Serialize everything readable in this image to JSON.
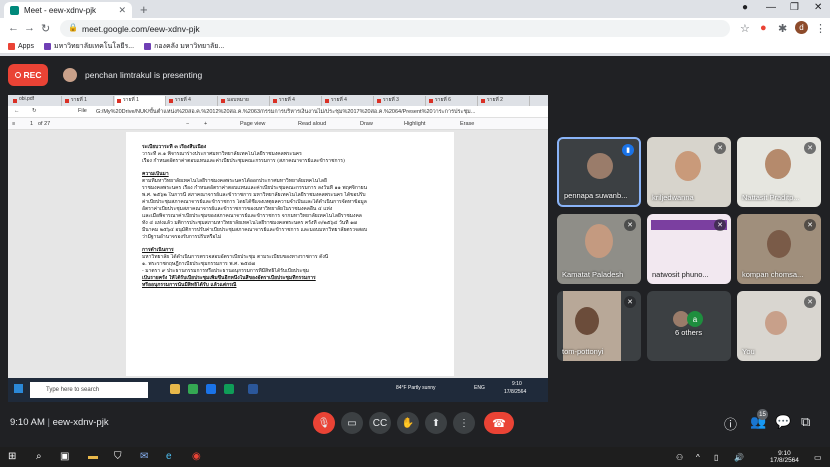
{
  "browser": {
    "tab_title": "Meet - eew-xdnv-pjk",
    "url": "meet.google.com/eew-xdnv-pjk",
    "bookmarks": [
      {
        "label": "Apps",
        "color": "#ea4335"
      },
      {
        "label": "มหาวิทยาลัยเทคโนโลยีร...",
        "color": "#6f3fb5"
      },
      {
        "label": "กองคลัง มหาวิทยาลัย...",
        "color": "#6f3fb5"
      }
    ],
    "profile_initial": "d"
  },
  "meet": {
    "rec_label": "REC",
    "presenting_text": "penchan limtrakul is presenting",
    "meeting_time": "9:10 AM",
    "meeting_code": "eew-xdnv-pjk",
    "participant_count": "15",
    "accent": "#1a73e8",
    "danger": "#ea4335"
  },
  "shared_screen": {
    "tabs": [
      "obi.pdf",
      "รายที่ 1",
      "รายที่ 1",
      "รายที่ 4",
      "มอบหมาย",
      "รายที่ 4",
      "รายที่ 4",
      "รายที่ 3",
      "รายที่ 6",
      "รายที่ 2"
    ],
    "file_label": "File",
    "url": "G:/My%20Drive/NUK/ขั้นตำแหน่ง%20สอ.ค.%2012%20สอ.ค.%2063/กรรมการบริหารเงินงานไม่/ประชุม%2017%20สอ.ค.%2064/Present%20วาระการประชุม...",
    "page_num": "1",
    "page_total": "of 27",
    "toolbar": [
      "Page view",
      "Read aloud",
      "Draw",
      "Highlight",
      "Erase"
    ],
    "doc_lines": [
      "ระเบียบวาระที่ ๓          เรื่องสืบเนื่อง",
      "        วาระที่ ๓.๑  พิจารณาร่างประกาศมหาวิทยาลัยเทคโนโลยีราชมงคลพระนคร",
      "เรื่อง กำหนดอัตราค่าตอบแทนและค่าเบี้ยประชุมคณะกรรมการ (สภาคณาจารย์และข้าราชการ)",
      "ความเป็นมา",
      "        ตามที่มหาวิทยาลัยเทคโนโลยีราชมงคลพระนครได้ออกประกาศมหาวิทยาลัยเทคโนโลยี",
      "ราชมงคลพระนคร เรื่อง กำหนดอัตราค่าตอบแทนและค่าเบี้ยประชุมคณะกรรมการ ลงวันที่ ๑๑ พฤศจิกายน",
      "พ.ศ. ๒๕๖๒ ในการนี้ สภาคณาจารย์และข้าราชการ มหาวิทยาลัยเทคโนโลยีราชมงคลพระนคร ได้ขอปรับ",
      "ค่าเบี้ยประชุมสภาคณาจารย์และข้าราชการ โดยได้ชี้แจงเหตุผลความจำเป็นและได้ดำเนินการจัดหาข้อมูล",
      "อัตราค่าเบี้ยประชุมสภาคณาจารย์และข้าราชการของมหาวิทยาลัยในราชมงคลอื่น ๔ แห่ง",
      "และเมื่อพิจารณาค่าเบี้ยประชุมของสภาคณาจารย์และข้าราชการ จากมหาวิทยาลัยเทคโนโลยีราชมงคล",
      "ทั้ง ๔ แห่งแล้ว มติการประชุมสภามหาวิทยาลัยเทคโนโลยีราชมงคลพระนคร ครั้งที่ ๓/๒๕๖๔ วันที่ ๑๗",
      "มีนาคม ๒๕๖๔ อนุมัติการปรับค่าเบี้ยประชุมสภาคณาจารย์และข้าราชการ และมอบมหาวิทยาลัยตรวจสอบ",
      "ว่ามีฐานอำนาจรองรับการปรับหรือไม่",
      "การดำเนินการ",
      "        มหาวิทยาลัย ได้ดำเนินการตรวจสอบอัตราเบี้ยประชุม ตามระเบียบของทางราชการ ดังนี้",
      "    ๑. พระราชกฤษฎีกาเบี้ยประชุมกรรมการ พ.ศ. ๒๕๔๗",
      "            - มาตรา ๙ ประธานกรรมการหรือประธานอนุกรรมการที่มีสิทธิได้รับเบี้ยประชุม",
      "            เป็นรายครั้ง ให้ได้รับเบี้ยประชุมเพิ่มขึ้นอีกหนึ่งในสี่ของอัตราเบี้ยประชุมที่กรรมการ",
      "            หรืออนุกรรมการนั้นมีสิทธิได้รับ แล้วแต่กรณี"
    ],
    "search_placeholder": "Type here to search",
    "weather": "84°F  Partly sunny",
    "lang": "ENG",
    "clock_time": "9:10",
    "clock_date": "17/8/2564"
  },
  "participants": [
    {
      "name": "pennapa suwanb...",
      "muted": false,
      "speaking": true
    },
    {
      "name": "kriljedwanna",
      "muted": true,
      "speaking": false
    },
    {
      "name": "Nattasit Praditp...",
      "muted": true,
      "speaking": false
    },
    {
      "name": "Kamatat Paladesh",
      "muted": true,
      "speaking": false
    },
    {
      "name": "natwosit phuno...",
      "muted": true,
      "speaking": false
    },
    {
      "name": "kompan chomsa...",
      "muted": true,
      "speaking": false
    },
    {
      "name": "tom-pottonyi",
      "muted": true,
      "speaking": false
    },
    {
      "name": "6 others",
      "muted": false,
      "speaking": false
    },
    {
      "name": "You",
      "muted": true,
      "speaking": false
    }
  ],
  "others_avatar_initial": "a",
  "taskbar": {
    "time": "9:10",
    "date": "17/8/2564"
  }
}
